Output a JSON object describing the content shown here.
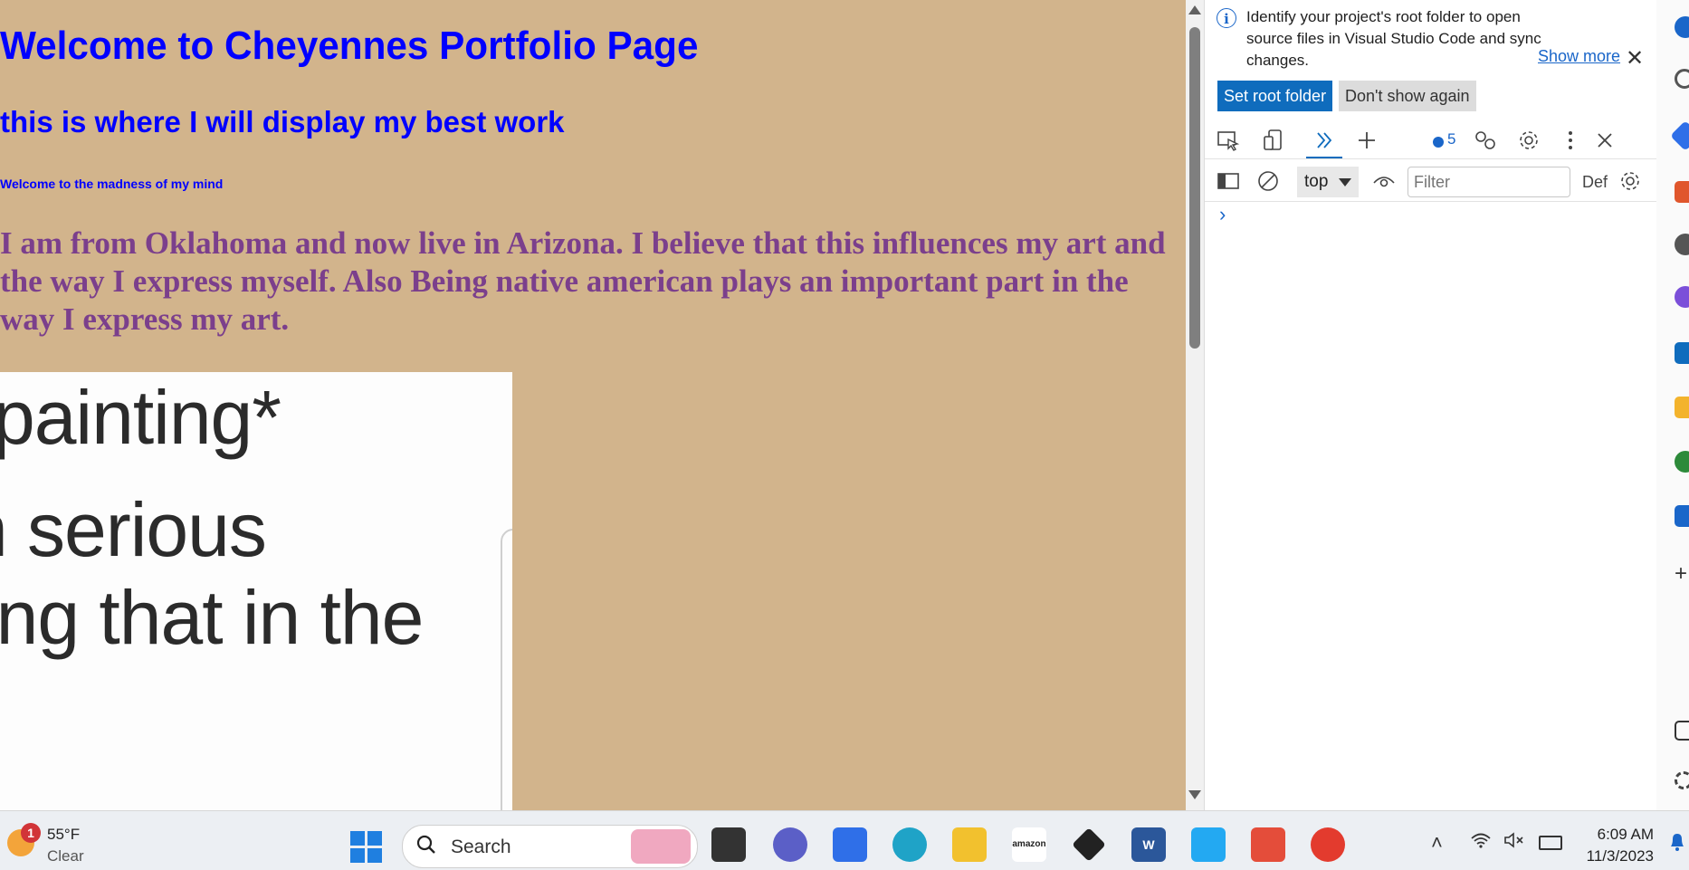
{
  "page": {
    "heading1": "Welcome to Cheyennes Portfolio Page",
    "heading2": "this is where I will display my best work",
    "heading6": "Welcome to the madness of my mind",
    "paragraph": "I am from Oklahoma and now live in Arizona. I believe that this influences my art and the way I express myself. Also Being native american plays an important part in the way I express my art.",
    "image_lines": [
      "painting*",
      "n serious",
      "ing that in the"
    ],
    "background_color": "#d2b48c",
    "heading_color": "#0000ff",
    "paragraph_color": "#7b3f8c"
  },
  "devtools": {
    "info_message": "Identify your project's root folder to open source files in Visual Studio Code and sync changes.",
    "show_more": "Show more",
    "set_root_folder": "Set root folder",
    "dont_show_again": "Don't show again",
    "message_count": "5",
    "context": "top",
    "filter_placeholder": "Filter",
    "levels_label": "Def",
    "prompt": "›"
  },
  "taskbar": {
    "weather_temp": "55°F",
    "weather_condition": "Clear",
    "weather_badge": "1",
    "search_label": "Search",
    "time": "6:09 AM",
    "date": "11/3/2023",
    "apps": [
      "task-view",
      "teams-chat",
      "microsoft-store",
      "edge",
      "file-explorer",
      "amazon",
      "dropbox",
      "word",
      "vscode",
      "snipping-tool",
      "chrome"
    ]
  }
}
